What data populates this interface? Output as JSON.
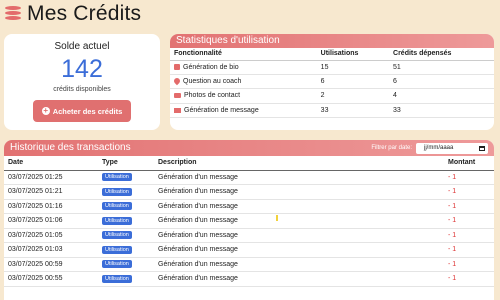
{
  "page": {
    "title": "Mes Crédits"
  },
  "balance": {
    "label": "Solde actuel",
    "value": "142",
    "sub": "crédits disponibles",
    "button": "Acheter des crédits"
  },
  "stats": {
    "title": "Statistiques d'utilisation",
    "headers": [
      "Fonctionnalité",
      "Utilisations",
      "Crédits dépensés"
    ],
    "rows": [
      {
        "icon": "document-icon",
        "color": "#e36b6b",
        "feature": "Génération de bio",
        "uses": "15",
        "credits": "51"
      },
      {
        "icon": "heart-icon",
        "color": "#e36b6b",
        "feature": "Question au coach",
        "uses": "6",
        "credits": "6"
      },
      {
        "icon": "photo-icon",
        "color": "#e36b6b",
        "feature": "Photos de contact",
        "uses": "2",
        "credits": "4"
      },
      {
        "icon": "envelope-icon",
        "color": "#e36b6b",
        "feature": "Génération de message",
        "uses": "33",
        "credits": "33"
      }
    ]
  },
  "history": {
    "title": "Historique des transactions",
    "filter_label": "Filtrer par date:",
    "date_placeholder": "jj/mm/aaaa",
    "headers": [
      "Date",
      "Type",
      "Description",
      "Montant"
    ],
    "rows": [
      {
        "date": "03/07/2025 01:25",
        "type": "Utilisation",
        "description": "Génération d'un message",
        "amount": "- 1"
      },
      {
        "date": "03/07/2025 01:21",
        "type": "Utilisation",
        "description": "Génération d'un message",
        "amount": "- 1"
      },
      {
        "date": "03/07/2025 01:16",
        "type": "Utilisation",
        "description": "Génération d'un message",
        "amount": "- 1"
      },
      {
        "date": "03/07/2025 01:06",
        "type": "Utilisation",
        "description": "Génération d'un message",
        "amount": "- 1"
      },
      {
        "date": "03/07/2025 01:05",
        "type": "Utilisation",
        "description": "Génération d'un message",
        "amount": "- 1"
      },
      {
        "date": "03/07/2025 01:03",
        "type": "Utilisation",
        "description": "Génération d'un message",
        "amount": "- 1"
      },
      {
        "date": "03/07/2025 00:59",
        "type": "Utilisation",
        "description": "Génération d'un message",
        "amount": "- 1"
      },
      {
        "date": "03/07/2025 00:55",
        "type": "Utilisation",
        "description": "Génération d'un message",
        "amount": "- 1"
      }
    ]
  }
}
